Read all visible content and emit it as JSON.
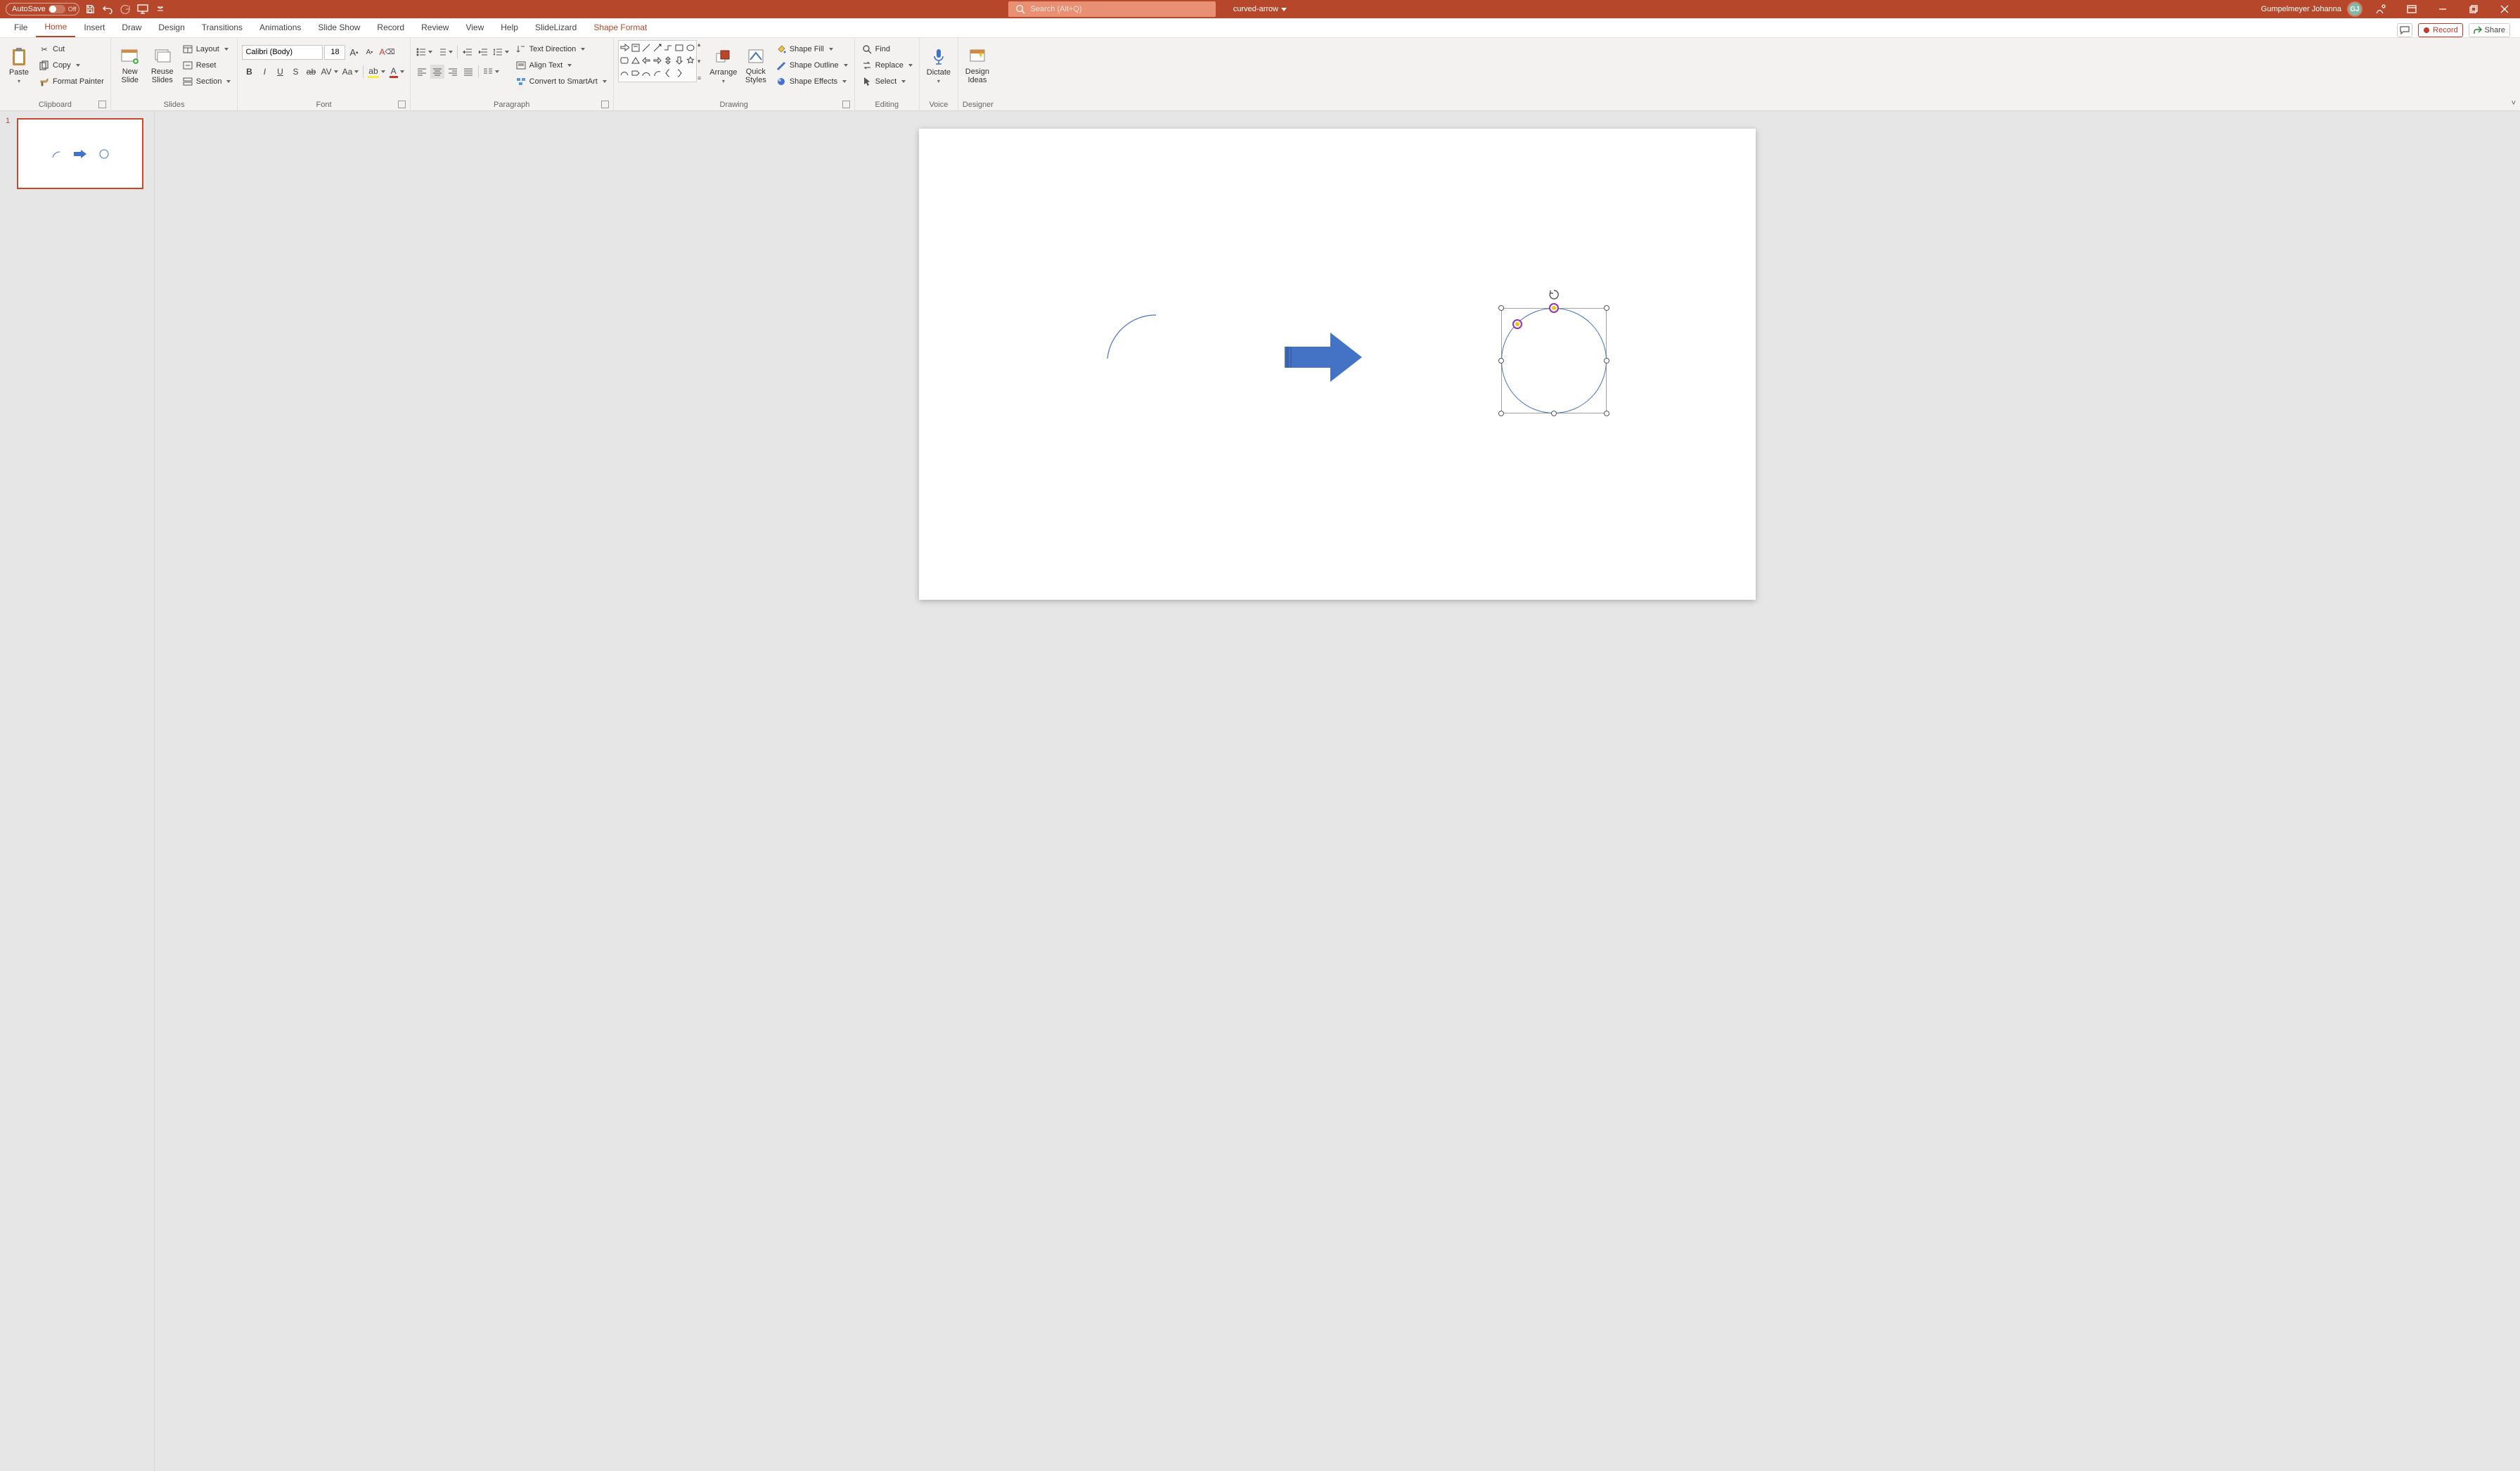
{
  "titlebar": {
    "autosave_label": "AutoSave",
    "autosave_state": "Off",
    "doc_name": "curved-arrow",
    "search_placeholder": "Search (Alt+Q)",
    "user_name": "Gumpelmeyer Johanna",
    "user_initials": "GJ"
  },
  "tabs": {
    "labels": [
      "File",
      "Home",
      "Insert",
      "Draw",
      "Design",
      "Transitions",
      "Animations",
      "Slide Show",
      "Record",
      "Review",
      "View",
      "Help",
      "SlideLizard",
      "Shape Format"
    ],
    "active_index": 1,
    "context_index": 13,
    "record_label": "Record",
    "share_label": "Share"
  },
  "ribbon": {
    "clipboard": {
      "label": "Clipboard",
      "paste": "Paste",
      "cut": "Cut",
      "copy": "Copy",
      "format_painter": "Format Painter"
    },
    "slides": {
      "label": "Slides",
      "new_slide": "New\nSlide",
      "reuse_slides": "Reuse\nSlides",
      "layout": "Layout",
      "reset": "Reset",
      "section": "Section"
    },
    "font": {
      "label": "Font",
      "font_name": "Calibri (Body)",
      "font_size": "18",
      "aa": "Aa",
      "bold": "B",
      "italic": "I",
      "underline": "U",
      "strike": "S",
      "shadow": "ab",
      "spacing": "AV",
      "font_color": "A",
      "highlight": "A"
    },
    "paragraph": {
      "label": "Paragraph",
      "text_direction": "Text Direction",
      "align_text": "Align Text",
      "convert_smartart": "Convert to SmartArt"
    },
    "drawing": {
      "label": "Drawing",
      "arrange": "Arrange",
      "quick_styles": "Quick\nStyles",
      "shape_fill": "Shape Fill",
      "shape_outline": "Shape Outline",
      "shape_effects": "Shape Effects"
    },
    "editing": {
      "label": "Editing",
      "find": "Find",
      "replace": "Replace",
      "select": "Select"
    },
    "voice": {
      "label": "Voice",
      "dictate": "Dictate"
    },
    "designer": {
      "label": "Designer",
      "design_ideas": "Design\nIdeas"
    }
  },
  "thumbnails": {
    "slides": [
      {
        "number": "1"
      }
    ]
  },
  "colors": {
    "brand": "#b7472a",
    "shape_blue": "#4472c4",
    "accent_purple": "#9b2fae",
    "adjust_yellow": "#f1c40f"
  },
  "canvas": {
    "selected_shape": "block-arc",
    "shapes": [
      "arc",
      "right-arrow",
      "block-arc-selected"
    ]
  }
}
